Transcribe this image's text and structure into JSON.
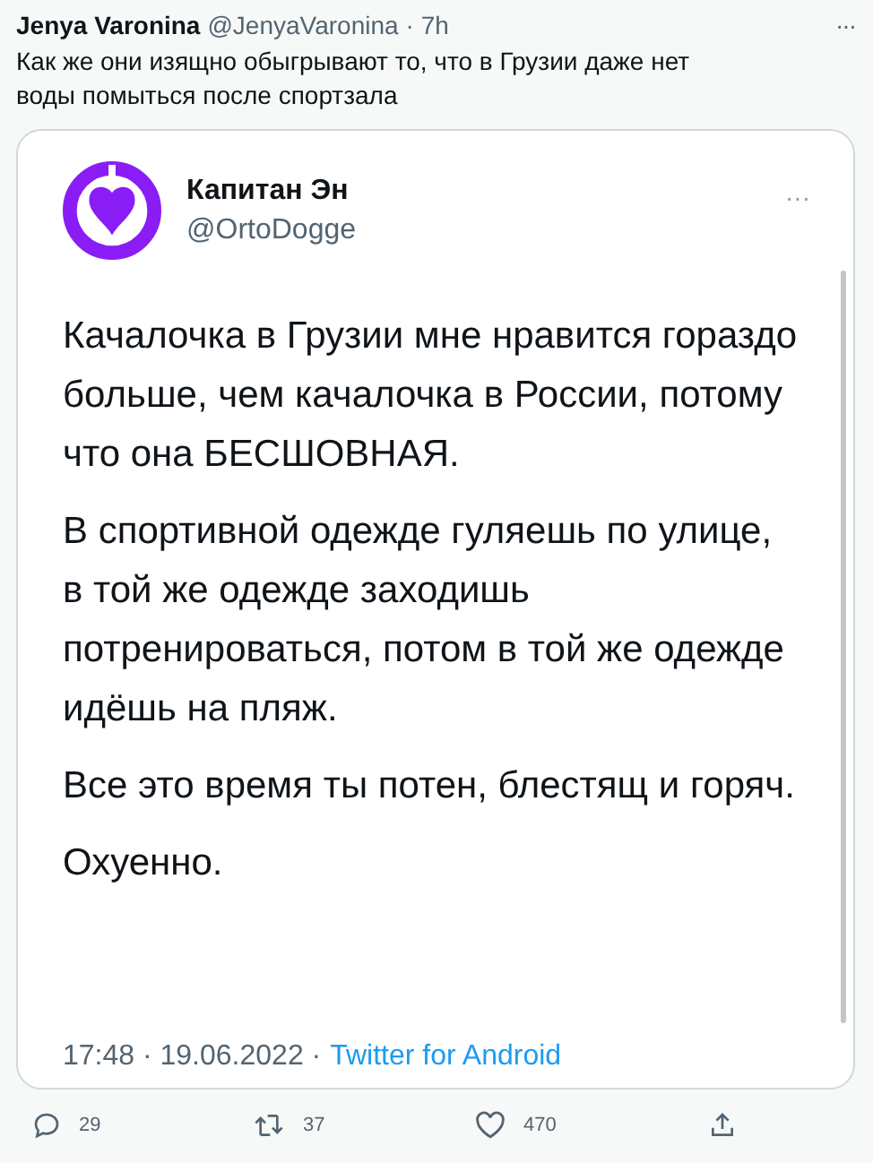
{
  "tweet": {
    "name": "Jenya Varonina",
    "handle": "@JenyaVaronina",
    "time": "· 7h",
    "more": "···",
    "text": "Как же они изящно обыгрывают то, что в Грузии даже нет воды помыться после спортзала"
  },
  "quoted": {
    "name": "Капитан Эн",
    "handle": "@OrtoDogge",
    "more": "···",
    "paragraphs": [
      "Качалочка в Грузии мне нравится гораздо больше, чем качалочка в России, потому что она БЕСШОВНАЯ.",
      "В спортивной одежде гуляешь по улице, в той же одежде заходишь потренироваться, потом в той же одежде идёшь на пляж.",
      "Все это время ты потен, блестящ и горяч.",
      "Охуенно."
    ],
    "timestamp": "17:48 · 19.06.2022 ·",
    "source": "Twitter for Android"
  },
  "actions": [
    {
      "kind": "reply",
      "count": "29"
    },
    {
      "kind": "retweet",
      "count": "37"
    },
    {
      "kind": "like",
      "count": "470"
    },
    {
      "kind": "share"
    }
  ]
}
